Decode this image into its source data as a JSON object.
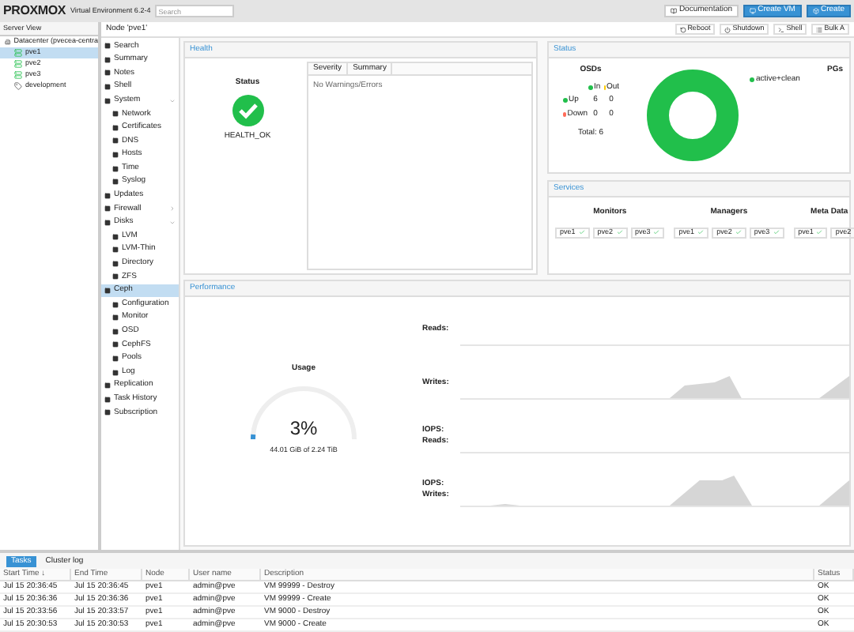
{
  "header": {
    "logo": "PROXMOX",
    "version": "Virtual Environment 6.2-4",
    "search": {
      "placeholder": "Search"
    },
    "buttons": [
      {
        "label": "Documentation",
        "kind": "plain"
      },
      {
        "label": "Create VM",
        "kind": "primary"
      },
      {
        "label": "Create",
        "kind": "primary"
      }
    ]
  },
  "tree": {
    "view": "Server View",
    "items": [
      {
        "label": "Datacenter (pvecea-centra",
        "kind": "datacenter",
        "selected": false,
        "children": [
          {
            "label": "pve1",
            "kind": "node",
            "selected": true
          },
          {
            "label": "pve2",
            "kind": "node",
            "selected": false
          },
          {
            "label": "pve3",
            "kind": "node",
            "selected": false
          },
          {
            "label": "development",
            "kind": "pool",
            "selected": false
          }
        ]
      }
    ]
  },
  "node_bar": {
    "title": "Node 'pve1'",
    "buttons": [
      "Reboot",
      "Shutdown",
      "Shell",
      "Bulk A"
    ]
  },
  "menu": [
    {
      "label": "Search",
      "selected": false
    },
    {
      "label": "Summary",
      "selected": false
    },
    {
      "label": "Notes",
      "selected": false
    },
    {
      "label": "Shell",
      "selected": false
    },
    {
      "label": "System",
      "selected": false,
      "expanded": true,
      "children": [
        {
          "label": "Network",
          "selected": false
        },
        {
          "label": "Certificates",
          "selected": false
        },
        {
          "label": "DNS",
          "selected": false
        },
        {
          "label": "Hosts",
          "selected": false
        },
        {
          "label": "Time",
          "selected": false
        },
        {
          "label": "Syslog",
          "selected": false
        }
      ]
    },
    {
      "label": "Updates",
      "selected": false
    },
    {
      "label": "Firewall",
      "selected": false,
      "expanded": false
    },
    {
      "label": "Disks",
      "selected": false,
      "expanded": true,
      "children": [
        {
          "label": "LVM",
          "selected": false
        },
        {
          "label": "LVM-Thin",
          "selected": false
        },
        {
          "label": "Directory",
          "selected": false
        },
        {
          "label": "ZFS",
          "selected": false
        }
      ]
    },
    {
      "label": "Ceph",
      "selected": true,
      "children": [
        {
          "label": "Configuration",
          "selected": false
        },
        {
          "label": "Monitor",
          "selected": false
        },
        {
          "label": "OSD",
          "selected": false
        },
        {
          "label": "CephFS",
          "selected": false
        },
        {
          "label": "Pools",
          "selected": false
        },
        {
          "label": "Log",
          "selected": false
        }
      ]
    },
    {
      "label": "Replication",
      "selected": false
    },
    {
      "label": "Task History",
      "selected": false
    },
    {
      "label": "Subscription",
      "selected": false
    }
  ],
  "health": {
    "title": "Health",
    "status_title": "Status",
    "status": "HEALTH_OK",
    "columns": [
      "Severity",
      "Summary"
    ],
    "empty": "No Warnings/Errors"
  },
  "status": {
    "title": "Status",
    "osds": {
      "title": "OSDs",
      "columns": [
        "In",
        "Out"
      ],
      "rows": [
        {
          "label": "Up",
          "color": "#21bf4b",
          "values": [
            "6",
            "0"
          ]
        },
        {
          "label": "Down",
          "color": "#ff6c59",
          "values": [
            "0",
            "0"
          ]
        }
      ],
      "total": "Total: 6"
    },
    "pgs": {
      "title": "PGs",
      "legend": [
        {
          "label": "active+clean",
          "color": "#21bf4b"
        }
      ]
    }
  },
  "services": {
    "title": "Services",
    "groups": [
      {
        "title": "Monitors",
        "items": [
          "pve1",
          "pve2",
          "pve3"
        ]
      },
      {
        "title": "Managers",
        "items": [
          "pve1",
          "pve2",
          "pve3"
        ]
      },
      {
        "title": "Meta Data",
        "items": [
          "pve1",
          "pve2"
        ]
      }
    ]
  },
  "performance": {
    "title": "Performance",
    "usage": {
      "title": "Usage",
      "value": "3%",
      "level": 0.03,
      "detail": "44.01 GiB of 2.24 TiB"
    },
    "graphs": [
      "Reads:",
      "Writes:",
      "IOPS: Reads:",
      "IOPS: Writes:"
    ]
  },
  "bottom": {
    "tabs": [
      {
        "label": "Tasks",
        "selected": true
      },
      {
        "label": "Cluster log",
        "selected": false
      }
    ],
    "columns": [
      "Start Time ↓",
      "End Time",
      "Node",
      "User name",
      "Description",
      "Status"
    ],
    "rows": [
      [
        "Jul 15 20:36:45",
        "Jul 15 20:36:45",
        "pve1",
        "admin@pve",
        "VM 99999 - Destroy",
        "OK"
      ],
      [
        "Jul 15 20:36:36",
        "Jul 15 20:36:36",
        "pve1",
        "admin@pve",
        "VM 99999 - Create",
        "OK"
      ],
      [
        "Jul 15 20:33:56",
        "Jul 15 20:33:57",
        "pve1",
        "admin@pve",
        "VM 9000 - Destroy",
        "OK"
      ],
      [
        "Jul 15 20:30:53",
        "Jul 15 20:30:53",
        "pve1",
        "admin@pve",
        "VM 9000 - Create",
        "OK"
      ]
    ]
  }
}
